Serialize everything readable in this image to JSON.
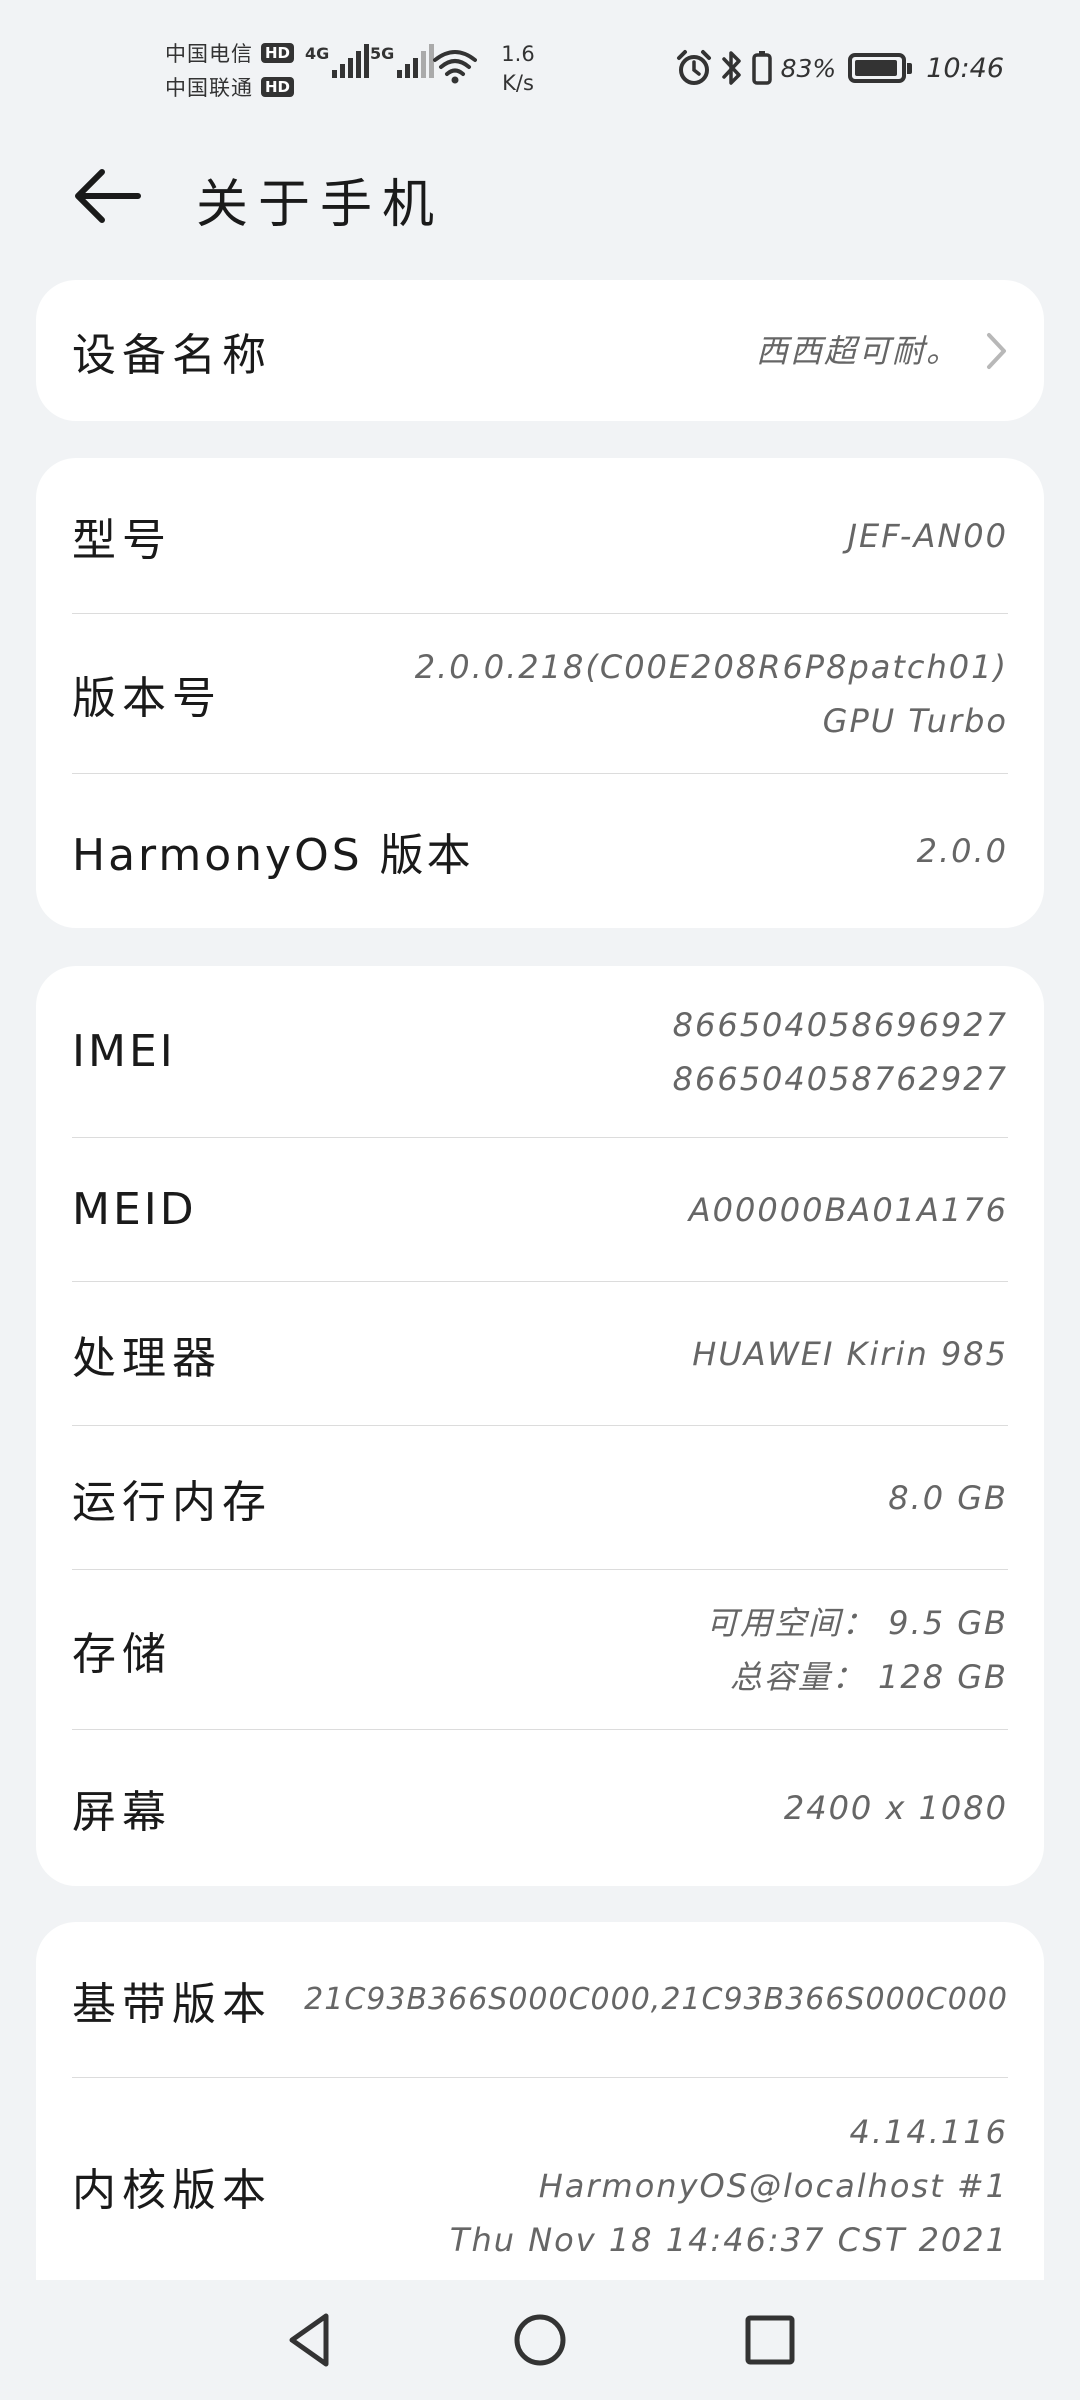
{
  "status_bar": {
    "carrier_1": "中国电信",
    "carrier_2": "中国联通",
    "hd_label": "HD",
    "net_type_1": "4G",
    "net_type_2": "5G",
    "speed_value": "1.6",
    "speed_unit": "K/s",
    "battery_percent": "83%",
    "time": "10:46",
    "icons": [
      "alarm-icon",
      "bluetooth-icon",
      "vibrate-icon",
      "battery-icon",
      "wifi-icon",
      "signal-icon"
    ]
  },
  "header": {
    "title": "关于手机",
    "back_icon": "arrow-left-icon"
  },
  "device_name": {
    "label": "设备名称",
    "value": "西西超可耐。"
  },
  "software": {
    "model_label": "型号",
    "model_value": "JEF-AN00",
    "version_label": "版本号",
    "version_line1": "2.0.0.218(C00E208R6P8patch01)",
    "version_line2": "GPU Turbo",
    "harmony_label": "HarmonyOS 版本",
    "harmony_value": "2.0.0"
  },
  "hardware": {
    "imei_label": "IMEI",
    "imei_1": "866504058696927",
    "imei_2": "866504058762927",
    "meid_label": "MEID",
    "meid_value": "A00000BA01A176",
    "cpu_label": "处理器",
    "cpu_value": "HUAWEI Kirin 985",
    "ram_label": "运行内存",
    "ram_value": "8.0 GB",
    "storage_label": "存储",
    "storage_available": "可用空间： 9.5  GB",
    "storage_total": "总容量： 128  GB",
    "screen_label": "屏幕",
    "screen_value": "2400 x 1080"
  },
  "firmware": {
    "baseband_label": "基带版本",
    "baseband_value": "21C93B366S000C000,21C93B366S000C000",
    "kernel_label": "内核版本",
    "kernel_line1": "4.14.116",
    "kernel_line2": "HarmonyOS@localhost #1",
    "kernel_line3": "Thu Nov 18 14:46:37 CST 2021"
  },
  "nav_bar": {
    "icons": [
      "back-triangle-icon",
      "home-circle-icon",
      "recents-square-icon"
    ]
  },
  "colors": {
    "background": "#f1f3f5",
    "card": "#ffffff",
    "label_text": "#1a1a1a",
    "value_text": "#666666",
    "divider": "#dcdcdc"
  }
}
